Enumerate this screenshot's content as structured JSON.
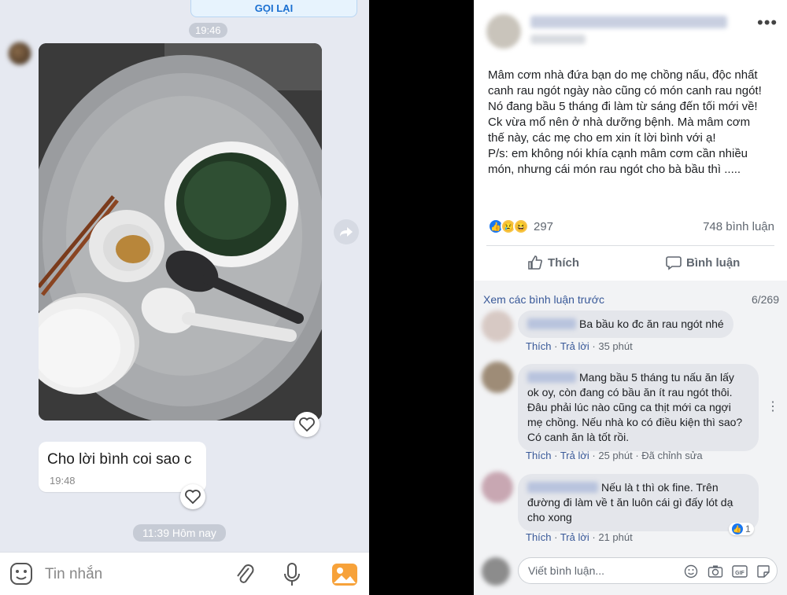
{
  "chat": {
    "callback_label": "GỌI LẠI",
    "time_top": "19:46",
    "message_text": "Cho lời bình coi sao c",
    "message_time": "19:48",
    "time_bottom": "11:39 Hôm nay",
    "input_placeholder": "Tin nhắn",
    "icons": [
      "emoji-icon",
      "attach-icon",
      "mic-icon",
      "image-icon",
      "heart-icon",
      "share-icon"
    ]
  },
  "post": {
    "more_label": "•••",
    "text_lines": [
      "Mâm cơm nhà đứa bạn do mẹ chồng nấu, độc nhất",
      "canh rau ngót ngày nào cũng có món canh rau ngót!",
      "Nó đang bầu 5 tháng đi làm từ sáng đến tối mới về!",
      "Ck vừa mổ nên ở nhà dưỡng bệnh. Mà mâm cơm",
      "thế này, các mẹ cho em xin ít lời bình với ạ!",
      "P/s: em không nói khía cạnh mâm cơm cần nhiều",
      "món, nhưng cái món rau ngót cho bà bầu thì ....."
    ],
    "reaction_count": "297",
    "comment_count": "748 bình luận",
    "like_label": "Thích",
    "comment_label": "Bình luận"
  },
  "comments": {
    "prev_link": "Xem các bình luận trước",
    "pager": "6/269",
    "items": [
      {
        "lines": [
          "Ba bầu ko đc ăn rau ngót nhé"
        ],
        "like": "Thích",
        "reply": "Trả lời",
        "time": "35 phút",
        "edited": ""
      },
      {
        "lines": [
          "Mang bầu 5 tháng tu nấu ăn lấy",
          "ok oy, còn đang có bầu ăn ít rau ngót thôi.",
          "Đâu phải lúc nào cũng ca thịt mới ca ngợi",
          "mẹ chồng. Nếu nhà ko có điều kiện thì sao?",
          "Có canh ăn là tốt rồi."
        ],
        "like": "Thích",
        "reply": "Trả lời",
        "time": "25 phút",
        "edited": "Đã chỉnh sửa"
      },
      {
        "lines": [
          "Nếu là t thì ok fine. Trên",
          "đường đi làm về t ăn luôn cái gì đấy lót dạ",
          "cho xong"
        ],
        "like": "Thích",
        "reply": "Trả lời",
        "time": "21 phút",
        "edited": "",
        "reaction_count": "1"
      }
    ],
    "write_placeholder": "Viết bình luận..."
  },
  "colors": {
    "chat_bg": "#e6e9f1",
    "fb_link": "#385898",
    "fb_like_blue": "#1877f2"
  }
}
